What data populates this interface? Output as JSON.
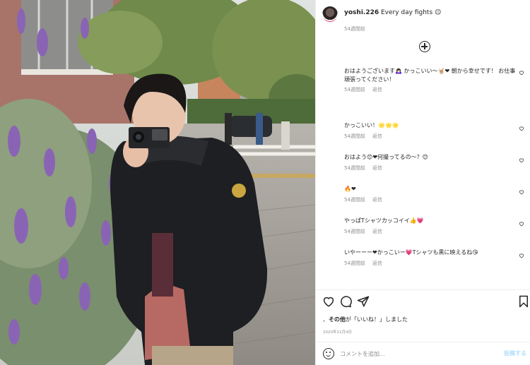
{
  "post": {
    "username": "yoshi.226",
    "caption": "Every day fights 😉",
    "caption_time": "54週間前"
  },
  "comments": [
    {
      "text": "おはようございます🙇🏻‍♀️ かっこいい〜🤘🏼❤︎ 朝から幸せです！ お仕事頑張ってください！",
      "time": "54週間前",
      "reply": "返信"
    },
    {
      "text": "かっこいい！🌟🌟🌟",
      "time": "54週間前",
      "reply": "返信"
    },
    {
      "text": "おはよう😊❤︎何撮ってるの〜？😊",
      "time": "54週間前",
      "reply": "返信"
    },
    {
      "text": "🔥❤︎",
      "time": "54週間前",
      "reply": "返信"
    },
    {
      "text": "やっぱTシャツカッコイイ👍💗",
      "time": "54週間前",
      "reply": "返信"
    },
    {
      "text": "いやーーー❤︎かっこいー💗Tシャツも黒に映えるね😘",
      "time": "54週間前",
      "reply": "返信"
    }
  ],
  "likes": {
    "prefix": "、",
    "others": "その他",
    "suffix": "が「いいね！」しました"
  },
  "post_date": "2020年11月4日",
  "add_comment": {
    "placeholder": "コメントを追加...",
    "post_label": "投稿する"
  },
  "icons": {
    "like": "heart-icon",
    "comment": "comment-bubble-icon",
    "share": "paper-plane-icon",
    "save": "bookmark-icon",
    "load_more": "plus-circle-icon",
    "emoji": "smiley-icon"
  }
}
